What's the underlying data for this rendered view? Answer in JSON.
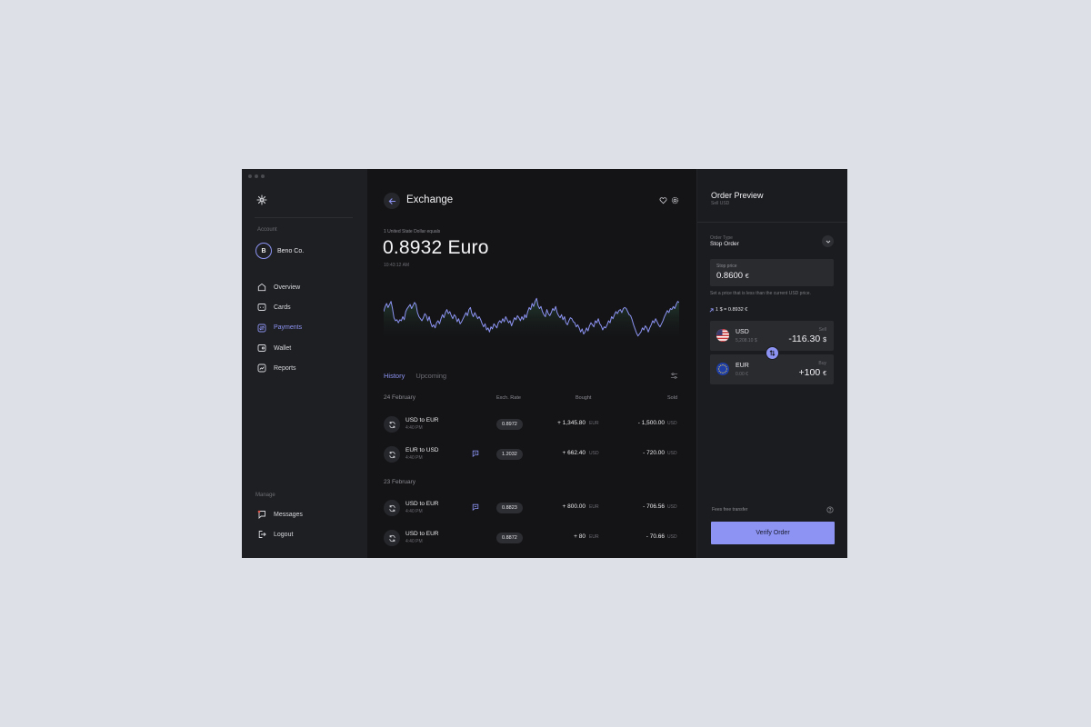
{
  "sidebar": {
    "account_section": "Account",
    "account_initial": "B",
    "account_name": "Beno Co.",
    "items": [
      {
        "label": "Overview",
        "icon": "home-icon"
      },
      {
        "label": "Cards",
        "icon": "card-icon"
      },
      {
        "label": "Payments",
        "icon": "payments-icon",
        "active": true
      },
      {
        "label": "Wallet",
        "icon": "wallet-icon"
      },
      {
        "label": "Reports",
        "icon": "reports-icon"
      }
    ],
    "manage_section": "Manage",
    "manage_items": [
      {
        "label": "Messages",
        "icon": "messages-icon"
      },
      {
        "label": "Logout",
        "icon": "logout-icon"
      }
    ]
  },
  "main": {
    "title": "Exchange",
    "rate_caption": "1 United State Dollar equals",
    "rate_value": "0.8932 Euro",
    "rate_time": "10:43:12 AM",
    "tabs": [
      {
        "label": "History",
        "active": true
      },
      {
        "label": "Upcoming",
        "active": false
      }
    ],
    "columns": {
      "rate": "Exch. Rate",
      "bought": "Bought",
      "sold": "Sold"
    },
    "groups": [
      {
        "date": "24 February",
        "rows": [
          {
            "pair": "USD to EUR",
            "time": "4:40 PM",
            "rate": "0.8972",
            "bought": "+ 1,345.80",
            "bought_cur": "EUR",
            "sold": "- 1,500.00",
            "sold_cur": "USD",
            "message": false
          },
          {
            "pair": "EUR to USD",
            "time": "4:40 PM",
            "rate": "1.2032",
            "bought": "+ 662.40",
            "bought_cur": "USD",
            "sold": "- 720.00",
            "sold_cur": "USD",
            "message": true
          }
        ]
      },
      {
        "date": "23 February",
        "rows": [
          {
            "pair": "USD to EUR",
            "time": "4:40 PM",
            "rate": "0.8823",
            "bought": "+ 800.00",
            "bought_cur": "EUR",
            "sold": "- 706.56",
            "sold_cur": "USD",
            "message": true
          },
          {
            "pair": "USD to EUR",
            "time": "4:40 PM",
            "rate": "0.8872",
            "bought": "+ 80",
            "bought_cur": "EUR",
            "sold": "- 70.66",
            "sold_cur": "USD",
            "message": false
          }
        ]
      }
    ]
  },
  "chart_data": {
    "type": "area",
    "values": [
      0.52,
      0.62,
      0.68,
      0.6,
      0.66,
      0.72,
      0.58,
      0.4,
      0.34,
      0.36,
      0.3,
      0.36,
      0.34,
      0.42,
      0.36,
      0.52,
      0.58,
      0.62,
      0.66,
      0.58,
      0.64,
      0.7,
      0.66,
      0.5,
      0.42,
      0.38,
      0.34,
      0.4,
      0.48,
      0.44,
      0.34,
      0.42,
      0.3,
      0.22,
      0.26,
      0.2,
      0.3,
      0.34,
      0.28,
      0.38,
      0.46,
      0.4,
      0.5,
      0.56,
      0.48,
      0.52,
      0.44,
      0.38,
      0.46,
      0.42,
      0.32,
      0.38,
      0.28,
      0.32,
      0.38,
      0.44,
      0.5,
      0.44,
      0.56,
      0.6,
      0.48,
      0.42,
      0.5,
      0.44,
      0.38,
      0.42,
      0.36,
      0.28,
      0.22,
      0.28,
      0.16,
      0.2,
      0.12,
      0.22,
      0.18,
      0.28,
      0.24,
      0.2,
      0.3,
      0.34,
      0.3,
      0.38,
      0.32,
      0.42,
      0.36,
      0.3,
      0.34,
      0.24,
      0.32,
      0.4,
      0.36,
      0.44,
      0.4,
      0.34,
      0.42,
      0.36,
      0.46,
      0.4,
      0.52,
      0.6,
      0.56,
      0.68,
      0.62,
      0.72,
      0.78,
      0.64,
      0.58,
      0.62,
      0.52,
      0.46,
      0.42,
      0.56,
      0.48,
      0.44,
      0.5,
      0.58,
      0.54,
      0.62,
      0.5,
      0.44,
      0.4,
      0.46,
      0.36,
      0.42,
      0.3,
      0.26,
      0.34,
      0.4,
      0.38,
      0.32,
      0.3,
      0.22,
      0.26,
      0.2,
      0.12,
      0.18,
      0.08,
      0.12,
      0.2,
      0.14,
      0.24,
      0.3,
      0.26,
      0.22,
      0.34,
      0.3,
      0.38,
      0.28,
      0.24,
      0.16,
      0.22,
      0.2,
      0.26,
      0.34,
      0.3,
      0.42,
      0.38,
      0.46,
      0.52,
      0.48,
      0.54,
      0.56,
      0.5,
      0.58,
      0.6,
      0.58,
      0.52,
      0.46,
      0.44,
      0.36,
      0.26,
      0.18,
      0.1,
      0.04,
      0.08,
      0.12,
      0.2,
      0.16,
      0.24,
      0.2,
      0.12,
      0.2,
      0.26,
      0.34,
      0.3,
      0.38,
      0.32,
      0.26,
      0.22,
      0.28,
      0.34,
      0.42,
      0.48,
      0.54,
      0.5,
      0.58,
      0.56,
      0.62,
      0.58,
      0.66,
      0.72,
      0.7
    ],
    "ylim": [
      0,
      1
    ]
  },
  "panel": {
    "title": "Order Preview",
    "subtitle": "Sell USD",
    "order_type_label": "Order Type",
    "order_type_value": "Stop Order",
    "stop_label": "Stop price",
    "stop_value": "0.8600",
    "stop_unit": "€",
    "stop_hint": "Set a price that is less than the current USD price.",
    "quote": "1 $ =  0.8932 €",
    "sell": {
      "code": "USD",
      "balance": "5,208.10 $",
      "side": "Sell",
      "amount": "-116.30",
      "unit": "$",
      "flag": "us-flag-icon"
    },
    "buy": {
      "code": "EUR",
      "balance": "0.00 €",
      "side": "Buy",
      "amount": "+100",
      "unit": "€",
      "flag": "eu-flag-icon"
    },
    "fees": "Fees free transfer",
    "verify_label": "Verify Order"
  },
  "colors": {
    "accent": "#8c93f2",
    "background": "#141416",
    "sidebar": "#1e1f22",
    "panel": "#1b1c1f"
  }
}
